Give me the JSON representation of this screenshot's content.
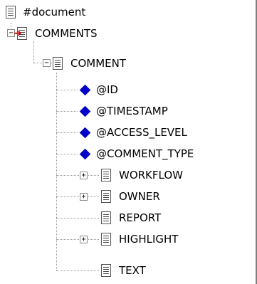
{
  "tree": {
    "root": {
      "label": "#document",
      "icon": "document-icon"
    },
    "nodes": [
      {
        "label": "COMMENTS",
        "icon": "element-red-arrow-icon",
        "expander": "−"
      },
      {
        "label": "COMMENT",
        "icon": "element-icon",
        "expander": "−"
      },
      {
        "label": "@ID",
        "icon": "attribute-diamond-icon"
      },
      {
        "label": "@TIMESTAMP",
        "icon": "attribute-diamond-icon"
      },
      {
        "label": "@ACCESS_LEVEL",
        "icon": "attribute-diamond-icon"
      },
      {
        "label": "@COMMENT_TYPE",
        "icon": "attribute-diamond-icon"
      },
      {
        "label": "WORKFLOW",
        "icon": "element-icon",
        "expander": "+"
      },
      {
        "label": "OWNER",
        "icon": "element-icon",
        "expander": "+"
      },
      {
        "label": "REPORT",
        "icon": "element-icon"
      },
      {
        "label": "HIGHLIGHT",
        "icon": "element-icon",
        "expander": "+"
      },
      {
        "label": "TEXT",
        "icon": "element-icon"
      }
    ]
  },
  "colors": {
    "attribute": "#0000c8",
    "marker": "#d20000",
    "connector": "#9a9a9a"
  }
}
